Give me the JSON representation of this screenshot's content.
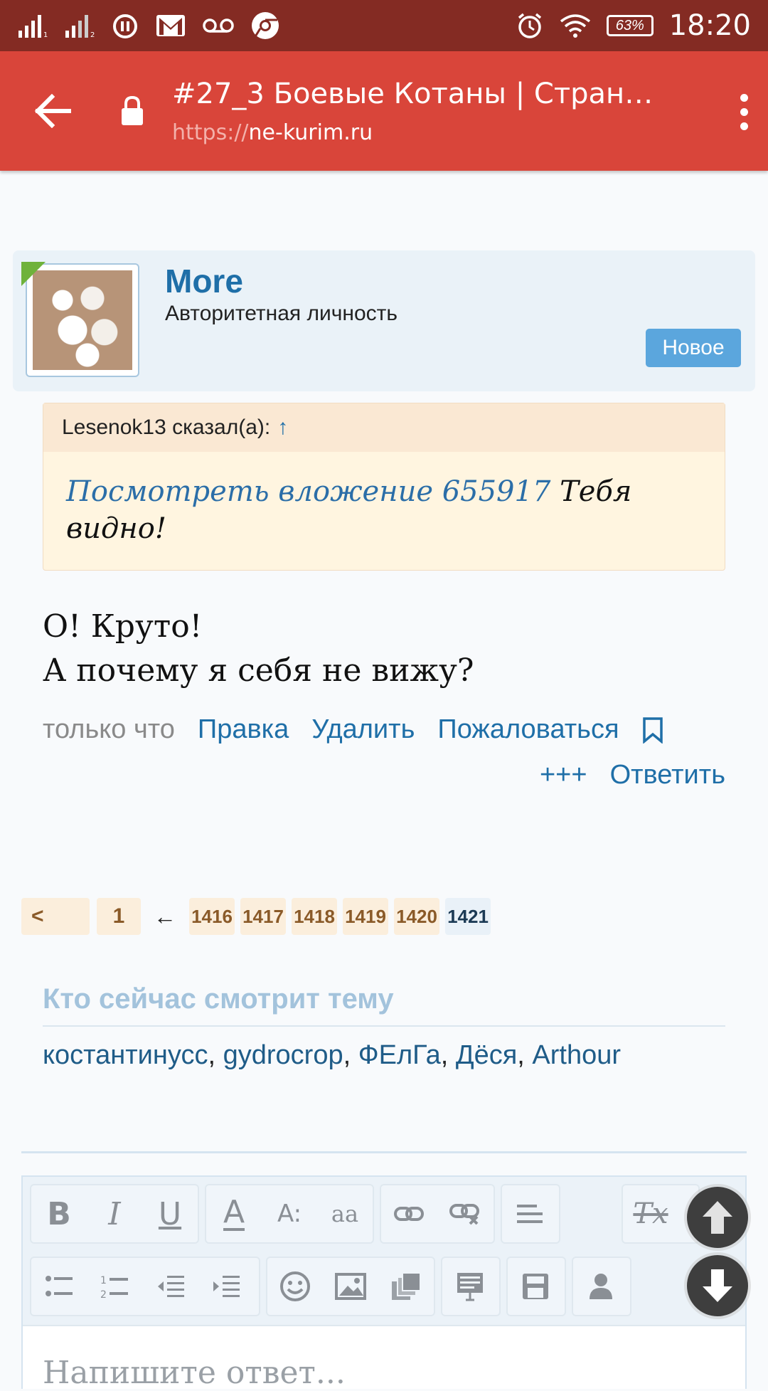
{
  "status_bar": {
    "time": "18:20",
    "battery": "63%",
    "icons": [
      "signal-icon",
      "signal-icon",
      "alarm-icon",
      "gmail-icon",
      "voicemail-icon",
      "chrome-icon",
      "alarm-icon",
      "wifi-icon",
      "battery-icon"
    ]
  },
  "toolbar": {
    "title": "#27_3 Боевые Котаны | Страниц…",
    "url_scheme": "https://",
    "url_host": "ne-kurim.ru"
  },
  "post": {
    "author": "More",
    "rank": "Авторитетная личность",
    "badge": "Новое",
    "quote": {
      "header": "Lesenok13 сказал(а):",
      "arrow": "↑",
      "link": "Посмотреть вложение 655917",
      "text": " Тебя видно!"
    },
    "message_line1": "О! Круто!",
    "message_line2": "А почему я себя не вижу?",
    "time": "только что",
    "actions": {
      "edit": "Правка",
      "delete": "Удалить",
      "report": "Пожаловаться",
      "plus": "+++",
      "reply": "Ответить"
    }
  },
  "pagination": {
    "prev": "<",
    "first": "1",
    "skip": "←",
    "pages": [
      "1416",
      "1417",
      "1418",
      "1419",
      "1420"
    ],
    "current": "1421"
  },
  "viewers": {
    "title": "Кто сейчас смотрит тему",
    "users": [
      "костантинусс",
      "gydrocrop",
      "ФЕлГа",
      "Дёся",
      "Arthour"
    ],
    "separator": ", "
  },
  "editor": {
    "placeholder": "Напишите ответ...",
    "bold": "B",
    "italic": "I",
    "underline": "U",
    "font_color": "A",
    "font_size": "A:",
    "font_family": "aa",
    "clear_format": "Tx"
  },
  "colors": {
    "status_bar": "#842b23",
    "toolbar": "#d9453a",
    "link": "#1f6fa8",
    "badge": "#5ba6dd"
  }
}
